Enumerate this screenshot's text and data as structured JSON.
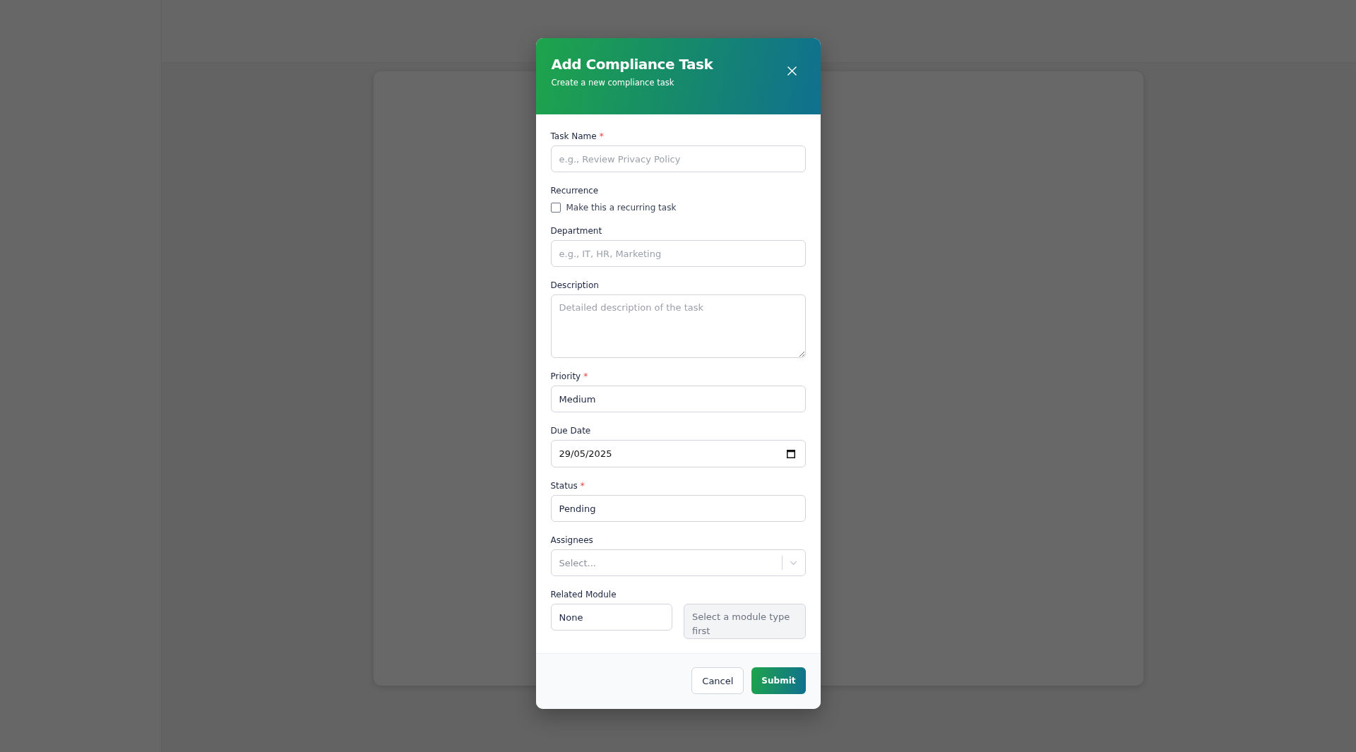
{
  "dialog": {
    "title": "Add Compliance Task",
    "subtitle": "Create a new compliance task",
    "fields": [
      {
        "kind": "text",
        "label": "Task Name",
        "required_mark": "*",
        "placeholder": "e.g., Review Privacy Policy"
      },
      {
        "kind": "checkbox",
        "label": "Recurrence",
        "option": "Make this a recurring task",
        "checked": false
      },
      {
        "kind": "text",
        "label": "Department",
        "placeholder": "e.g., IT, HR, Marketing"
      },
      {
        "kind": "textarea",
        "label": "Description",
        "placeholder": "Detailed description of the task"
      },
      {
        "kind": "select",
        "label": "Priority",
        "required_mark": "*",
        "value": "Medium"
      },
      {
        "kind": "date",
        "label": "Due Date",
        "value": "29/05/2025"
      },
      {
        "kind": "select",
        "label": "Status",
        "required_mark": "*",
        "value": "Pending"
      },
      {
        "kind": "combo",
        "label": "Assignees",
        "placeholder": "Select..."
      },
      {
        "kind": "pair",
        "label": "Related Module",
        "value": "None",
        "second_placeholder": "Select a module type first",
        "second_disabled": true
      }
    ],
    "buttons": [
      {
        "kind": "secondary",
        "label": "Cancel"
      },
      {
        "kind": "primary",
        "label": "Submit"
      }
    ]
  }
}
